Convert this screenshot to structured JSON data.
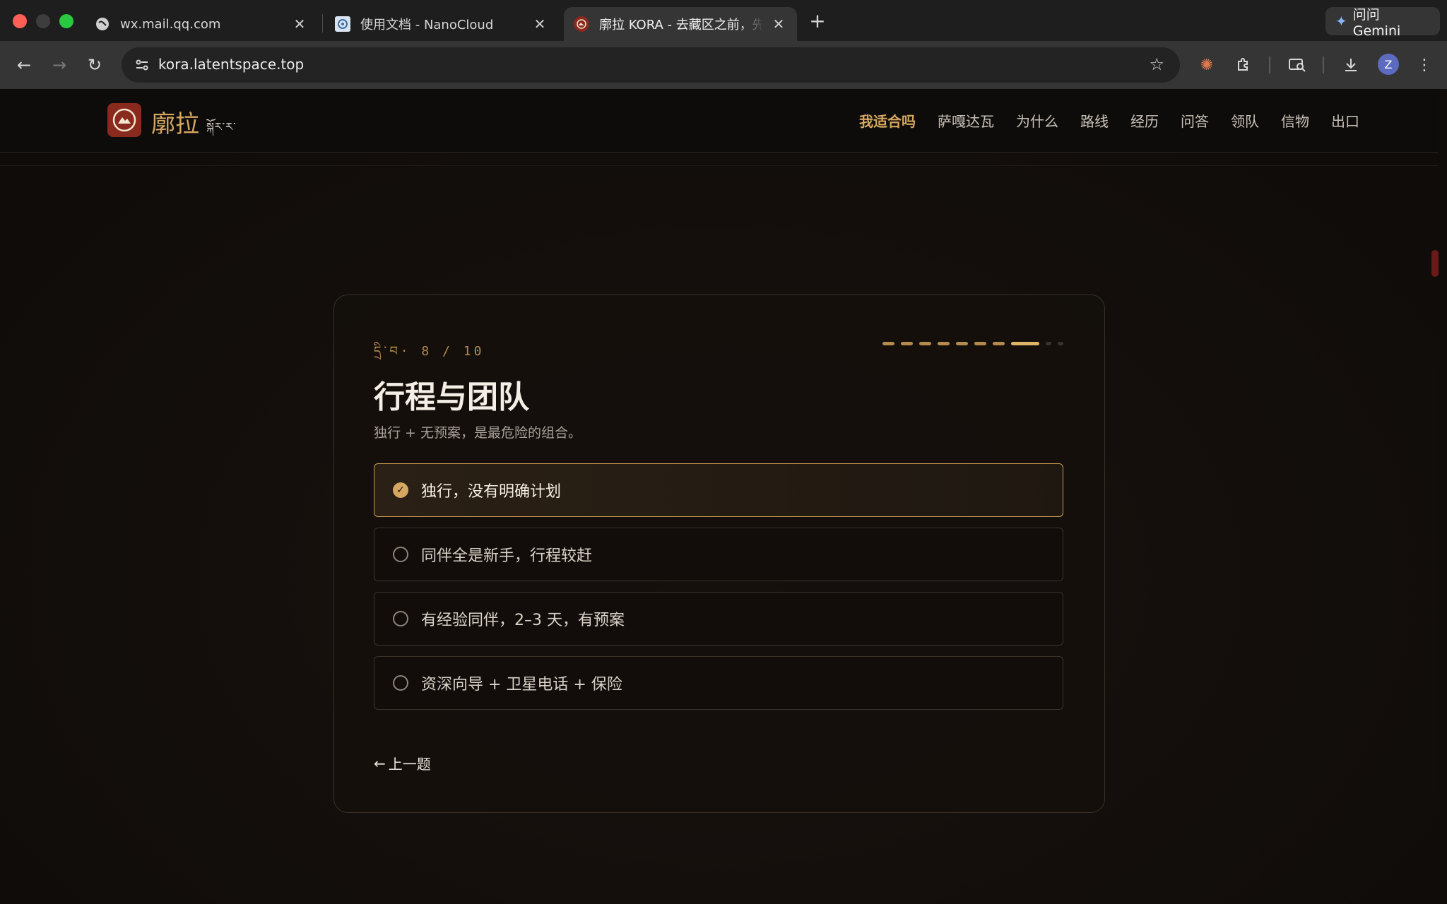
{
  "browser": {
    "tabs": [
      {
        "title": "wx.mail.qq.com"
      },
      {
        "title": "使用文档 - NanoCloud"
      },
      {
        "title": "廓拉 KORA - 去藏区之前，先学会在风里抉择"
      }
    ],
    "gemini_label": "问问 Gemini",
    "url": "kora.latentspace.top",
    "avatar_letter": "Z"
  },
  "site": {
    "logo_text": "廓拉",
    "logo_tibetan": "སྐོར་ར་",
    "nav": [
      {
        "label": "我适合吗",
        "active": true
      },
      {
        "label": "萨嘎达瓦"
      },
      {
        "label": "为什么"
      },
      {
        "label": "路线"
      },
      {
        "label": "经历"
      },
      {
        "label": "问答"
      },
      {
        "label": "领队"
      },
      {
        "label": "信物"
      },
      {
        "label": "出口"
      }
    ]
  },
  "quiz": {
    "step_label": "དྲི་བ· 8 / 10",
    "current": 8,
    "total": 10,
    "title": "行程与团队",
    "subtitle": "独行 + 无预案，是最危险的组合。",
    "options": [
      {
        "label": "独行，没有明确计划",
        "selected": true
      },
      {
        "label": "同伴全是新手，行程较赶",
        "selected": false
      },
      {
        "label": "有经验同伴，2–3 天，有预案",
        "selected": false
      },
      {
        "label": "资深向导 + 卫星电话 + 保险",
        "selected": false
      }
    ],
    "prev_label": "上一题",
    "prev_arrow": "←"
  },
  "colors": {
    "accent": "#d6a85f",
    "background": "#0f0c0a",
    "logo_bg": "#8a2a1f"
  }
}
